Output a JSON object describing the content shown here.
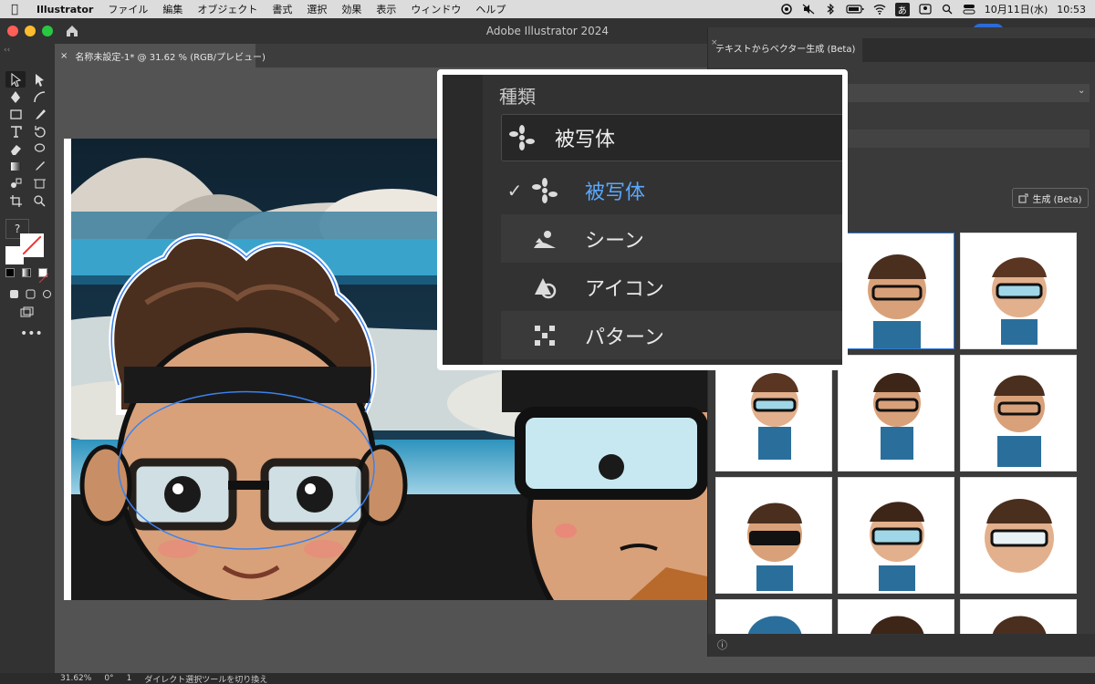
{
  "menubar": {
    "app_name": "Illustrator",
    "items": [
      "ファイル",
      "編集",
      "オブジェクト",
      "書式",
      "選択",
      "効果",
      "表示",
      "ウィンドウ",
      "ヘルプ"
    ],
    "input_mode": "あ",
    "date": "10月11日(水)",
    "time": "10:53"
  },
  "window": {
    "title": "Adobe Illustrator 2024"
  },
  "document_tab": {
    "close": "×",
    "label": "名称未設定-1* @ 31.62 % (RGB/プレビュー)"
  },
  "toolbar": {
    "help_label": "?"
  },
  "panel": {
    "close": "×",
    "title": "テキストからベクター生成 (Beta)",
    "generate_button": "生成 (Beta)",
    "thumbnail_count": 12
  },
  "callout": {
    "type_label": "種類",
    "selected_value": "被写体",
    "options": [
      {
        "label": "被写体",
        "icon": "subject-icon",
        "checked": true
      },
      {
        "label": "シーン",
        "icon": "scene-icon",
        "checked": false
      },
      {
        "label": "アイコン",
        "icon": "icon-icon",
        "checked": false
      },
      {
        "label": "パターン",
        "icon": "pattern-icon",
        "checked": false
      }
    ]
  },
  "status": {
    "zoom": "31.62%",
    "rotation": "0°",
    "artboard": "1",
    "hint": "ダイレクト選択ツールを切り換え"
  },
  "colors": {
    "accent_blue": "#5aa8ff",
    "selection_blue": "#2f7ad8",
    "ui_dark": "#323232"
  }
}
